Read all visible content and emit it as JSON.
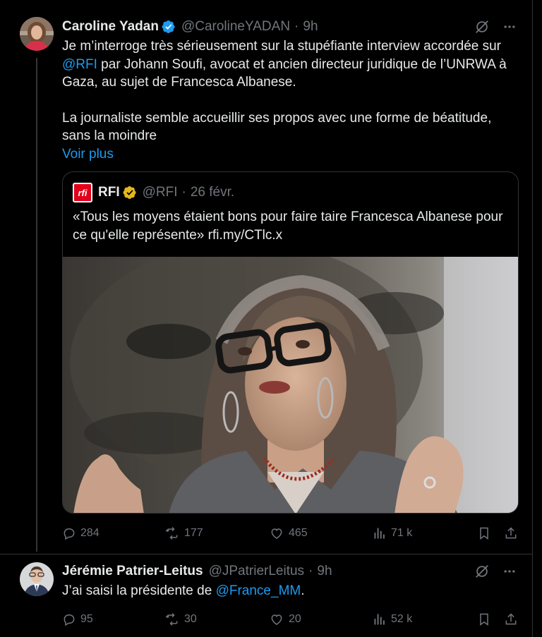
{
  "tweets": [
    {
      "name": "Caroline Yadan",
      "handle": "@CarolineYADAN",
      "separator": "·",
      "time": "9h",
      "body": {
        "para1_part1": "Je m’interroge très sérieusement sur la stupéfiante interview accordée sur",
        "mention": "@RFI",
        "para1_part2": " par Johann Soufi, avocat et ancien directeur juridique de l’UNRWA à Gaza, au sujet de Francesca Albanese.",
        "para2": "La journaliste semble accueillir ses propos avec une forme de béatitude, sans la moindre",
        "show_more": "Voir plus"
      },
      "quote": {
        "logo_text": "rfi",
        "name": "RFI",
        "handle": "@RFI",
        "separator": "·",
        "time": "26 févr.",
        "text": "«Tous les moyens étaient bons pour faire taire Francesca Albanese pour ce qu'elle représente» rfi.my/CTlc.x"
      },
      "actions": {
        "replies": "284",
        "reposts": "177",
        "likes": "465",
        "views": "71 k"
      }
    },
    {
      "name": "Jérémie Patrier-Leitus",
      "handle": "@JPatrierLeitus",
      "separator": "·",
      "time": "9h",
      "body": {
        "text_before": "J’ai saisi la présidente de ",
        "mention": "@France_MM",
        "text_after": "."
      },
      "actions": {
        "replies": "95",
        "reposts": "30",
        "likes": "20",
        "views": "52 k"
      }
    }
  ],
  "colors": {
    "background": "#000000",
    "text": "#e7e9ea",
    "muted": "#71767b",
    "link": "#1d9bf0",
    "verified_blue": "#1d9bf0",
    "verified_gold": "#e2b719",
    "border": "#2f3336",
    "rfi_red": "#e2001a"
  },
  "icons": [
    "verified-badge-icon",
    "grok-icon",
    "more-icon",
    "reply-icon",
    "repost-icon",
    "like-icon",
    "views-icon",
    "bookmark-icon",
    "share-icon"
  ]
}
